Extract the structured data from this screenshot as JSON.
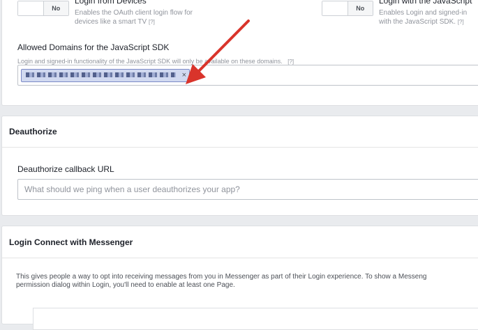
{
  "login_from_devices": {
    "title": "Login from Devices",
    "toggle_label": "No",
    "desc_line1": "Enables the OAuth client login flow for",
    "desc_line2": "devices like a smart TV",
    "help": "[?]"
  },
  "login_with_js": {
    "title": "Login with the JavaScript",
    "toggle_label": "No",
    "desc_line1": "Enables Login and signed-in",
    "desc_line2": "with the JavaScript SDK.",
    "help": "[?]"
  },
  "allowed_domains": {
    "title": "Allowed Domains for the JavaScript SDK",
    "description": "Login and signed-in functionality of the JavaScript SDK will only be available on these domains.",
    "help": "[?]",
    "token_remove": "×"
  },
  "deauthorize": {
    "section_title": "Deauthorize",
    "field_title": "Deauthorize callback URL",
    "placeholder": "What should we ping when a user deauthorizes your app?"
  },
  "messenger": {
    "section_title": "Login Connect with Messenger",
    "desc_line1": "This gives people a way to opt into receiving messages from you in Messenger as part of their Login experience. To show a Messeng",
    "desc_line2": "permission dialog within Login, you'll need to enable at least one Page."
  },
  "colors": {
    "annotation_arrow": "#d9342b",
    "token_bg": "#d1d9f0"
  }
}
